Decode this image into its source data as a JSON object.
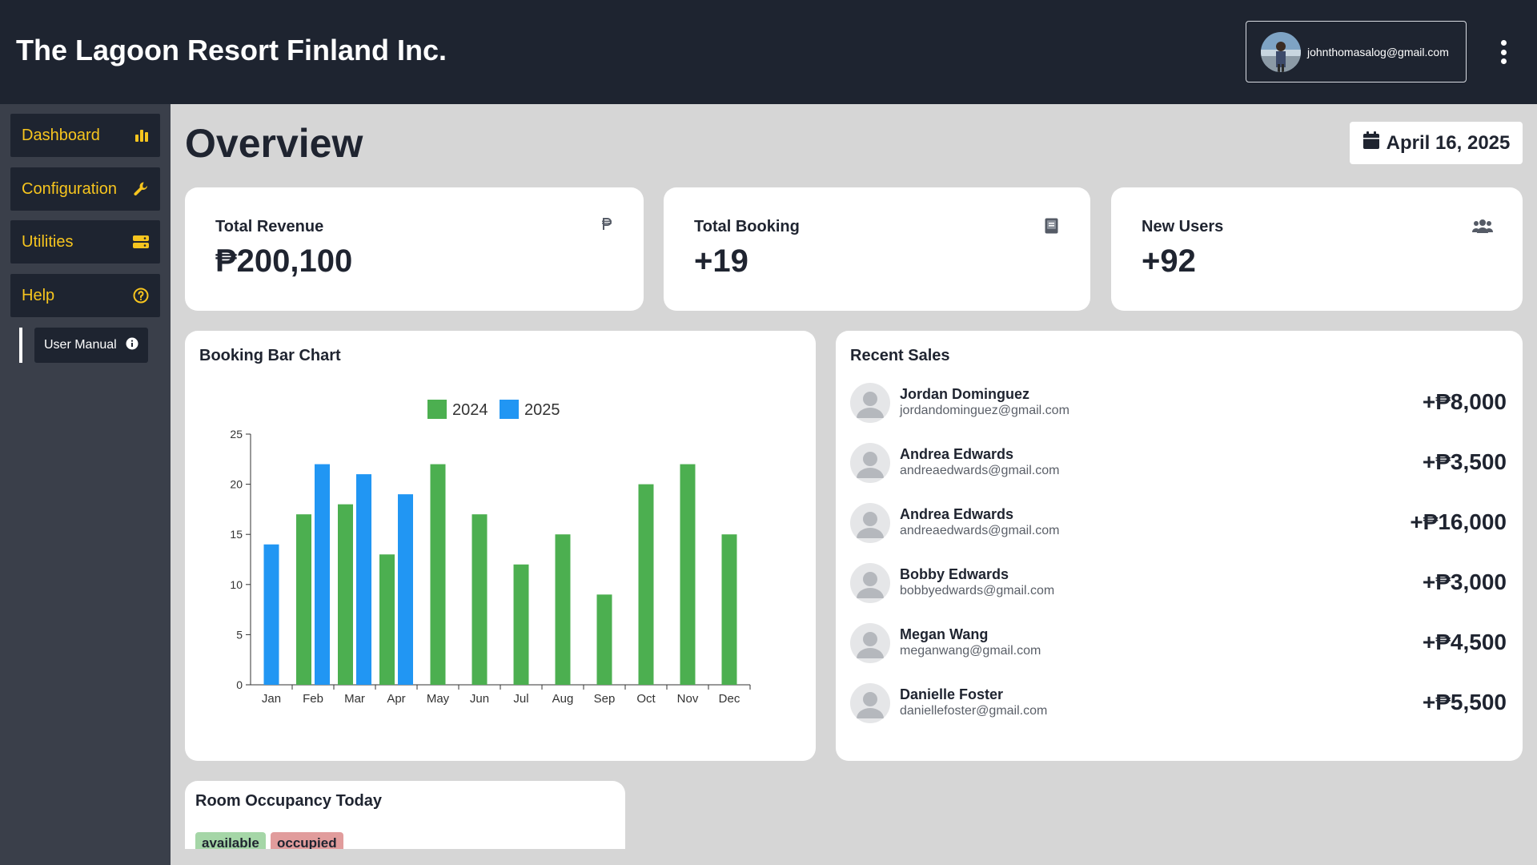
{
  "header": {
    "brand": "The Lagoon Resort Finland Inc.",
    "user_email": "johnthomasalog@gmail.com"
  },
  "sidebar": {
    "items": [
      {
        "label": "Dashboard",
        "icon": "bar-chart-icon"
      },
      {
        "label": "Configuration",
        "icon": "wrench-icon"
      },
      {
        "label": "Utilities",
        "icon": "server-icon"
      },
      {
        "label": "Help",
        "icon": "question-circle-icon"
      }
    ],
    "sub_items": [
      {
        "label": "User Manual",
        "icon": "info-icon"
      }
    ]
  },
  "main": {
    "title": "Overview",
    "date": "April 16, 2025"
  },
  "stats": [
    {
      "label": "Total Revenue",
      "value": "₱200,100",
      "icon": "peso-icon"
    },
    {
      "label": "Total Booking",
      "value": "+19",
      "icon": "book-icon"
    },
    {
      "label": "New Users",
      "value": "+92",
      "icon": "users-icon"
    }
  ],
  "chart_panel": {
    "title": "Booking Bar Chart"
  },
  "chart_data": {
    "type": "bar",
    "categories": [
      "Jan",
      "Feb",
      "Mar",
      "Apr",
      "May",
      "Jun",
      "Jul",
      "Aug",
      "Sep",
      "Oct",
      "Nov",
      "Dec"
    ],
    "series": [
      {
        "name": "2024",
        "color": "#4caf50",
        "values": [
          null,
          17,
          18,
          13,
          22,
          17,
          12,
          15,
          9,
          20,
          22,
          15
        ]
      },
      {
        "name": "2025",
        "color": "#2196f3",
        "values": [
          14,
          22,
          21,
          19,
          null,
          null,
          null,
          null,
          null,
          null,
          null,
          null
        ]
      }
    ],
    "ylim": [
      0,
      25
    ],
    "yticks": [
      0,
      5,
      10,
      15,
      20,
      25
    ],
    "legend": "top-center",
    "grid": false
  },
  "sales_panel": {
    "title": "Recent Sales",
    "rows": [
      {
        "name": "Jordan Dominguez",
        "email": "jordandominguez@gmail.com",
        "amount": "+₱8,000"
      },
      {
        "name": "Andrea Edwards",
        "email": "andreaedwards@gmail.com",
        "amount": "+₱3,500"
      },
      {
        "name": "Andrea Edwards",
        "email": "andreaedwards@gmail.com",
        "amount": "+₱16,000"
      },
      {
        "name": "Bobby Edwards",
        "email": "bobbyedwards@gmail.com",
        "amount": "+₱3,000"
      },
      {
        "name": "Megan Wang",
        "email": "meganwang@gmail.com",
        "amount": "+₱4,500"
      },
      {
        "name": "Danielle Foster",
        "email": "daniellefoster@gmail.com",
        "amount": "+₱5,500"
      }
    ]
  },
  "occupancy_panel": {
    "title": "Room Occupancy Today",
    "badges": [
      {
        "label": "available",
        "color": "#a5d6a7"
      },
      {
        "label": "occupied",
        "color": "#e19c9c"
      }
    ]
  }
}
